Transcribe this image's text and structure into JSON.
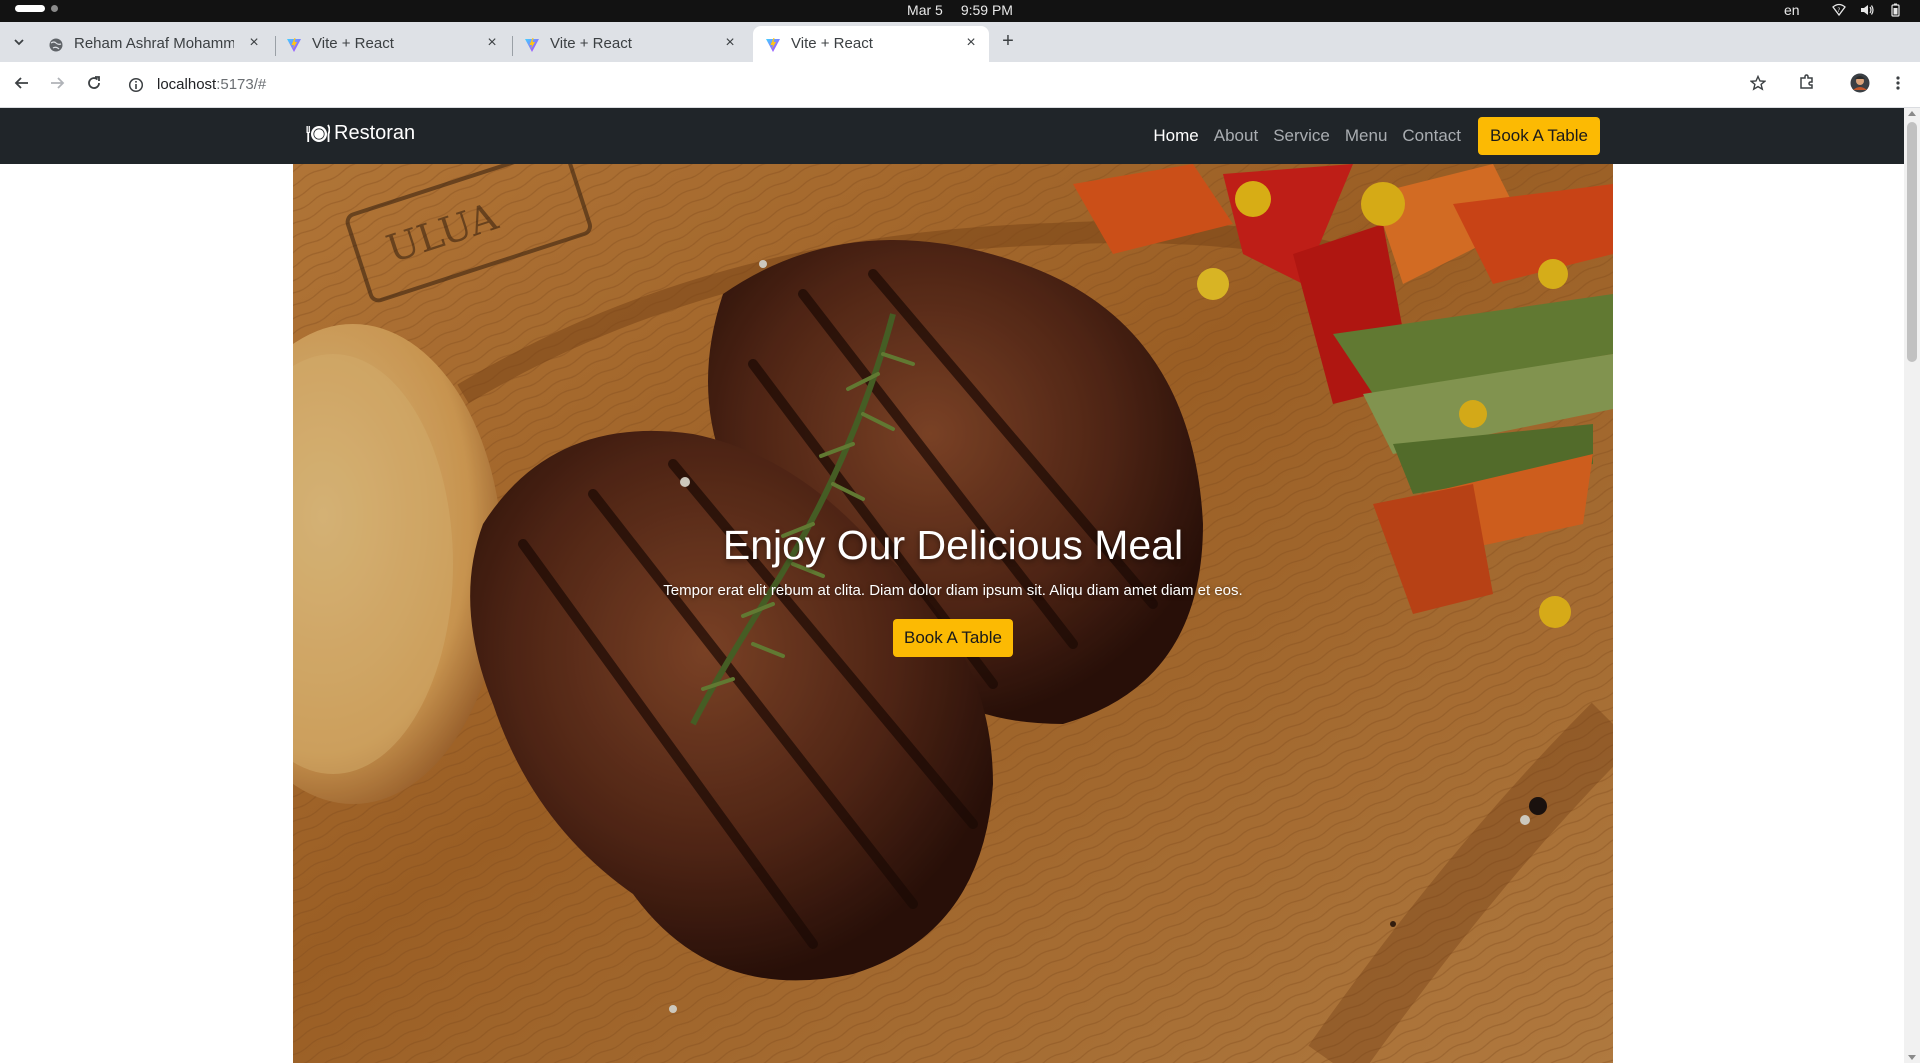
{
  "os": {
    "date": "Mar 5",
    "time": "9:59 PM",
    "lang": "en",
    "icons": [
      "network-icon",
      "volume-icon",
      "battery-icon"
    ]
  },
  "browser": {
    "tabs": [
      {
        "title": "Reham Ashraf Mohamme",
        "favicon": "globe-icon",
        "active": false
      },
      {
        "title": "Vite + React",
        "favicon": "vite-icon",
        "active": false
      },
      {
        "title": "Vite + React",
        "favicon": "vite-icon",
        "active": false
      },
      {
        "title": "Vite + React",
        "favicon": "vite-icon",
        "active": true
      }
    ],
    "url_host": "localhost",
    "url_rest": ":5173/#"
  },
  "site": {
    "brand": "Restoran",
    "brand_icon": "utensils-icon",
    "nav": {
      "home": "Home",
      "about": "About",
      "service": "Service",
      "menu": "Menu",
      "contact": "Contact",
      "cta": "Book A Table"
    },
    "hero": {
      "title": "Enjoy Our Delicious Meal",
      "subtitle": "Tempor erat elit rebum at clita. Diam dolor diam ipsum sit. Aliqu diam amet diam et eos.",
      "cta": "Book A Table"
    }
  },
  "colors": {
    "accent": "#fcba03",
    "navbar": "#202529",
    "os_bar": "#121212"
  }
}
